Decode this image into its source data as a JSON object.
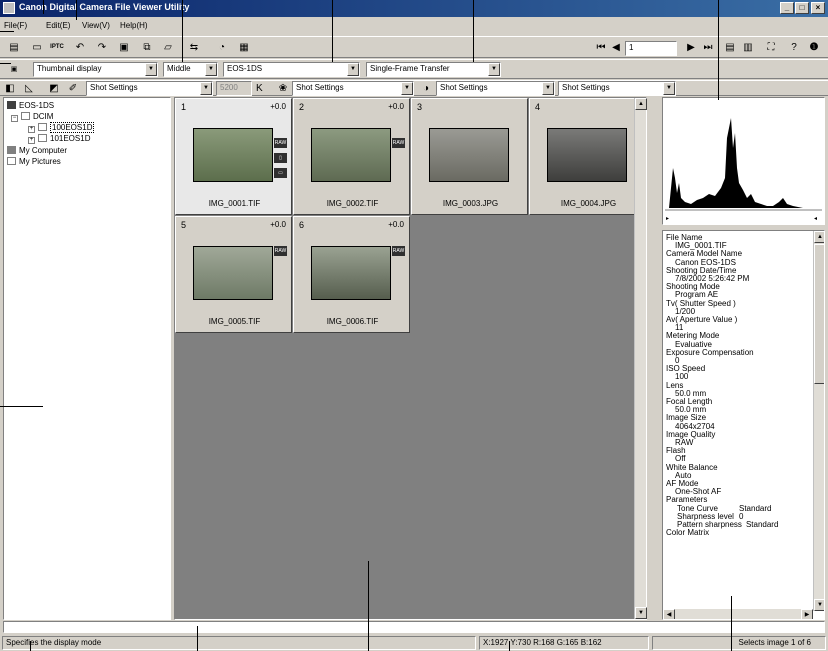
{
  "window": {
    "title": "Canon Digital Camera File Viewer Utility",
    "controls": [
      "_",
      "□",
      "×"
    ]
  },
  "menu": {
    "items": [
      "File(F)",
      "Edit(E)",
      "View(V)",
      "Help(H)"
    ]
  },
  "toolbar1": {
    "iptc": "IPTC",
    "page_value": "1"
  },
  "toolbar2": {
    "display_mode": "Thumbnail display",
    "size": "Middle",
    "camera": "EOS-1DS",
    "transfer": "Single-Frame Transfer"
  },
  "toolbar3": {
    "shot_settings_1": "Shot Settings",
    "kelvin_value": "5200",
    "kelvin_unit": "K",
    "shot_settings_2": "Shot Settings",
    "shot_settings_3": "Shot Settings",
    "shot_settings_4": "Shot Settings"
  },
  "tree": {
    "root": "EOS-1DS",
    "dcim": "DCIM",
    "folder1": "100EOS1D",
    "folder2": "101EOS1D",
    "my_computer": "My Computer",
    "my_pictures": "My Pictures"
  },
  "thumbnails": [
    {
      "num": "1",
      "exp": "+0.0",
      "name": "IMG_0001.TIF"
    },
    {
      "num": "2",
      "exp": "+0.0",
      "name": "IMG_0002.TIF"
    },
    {
      "num": "3",
      "exp": "",
      "name": "IMG_0003.JPG"
    },
    {
      "num": "4",
      "exp": "",
      "name": "IMG_0004.JPG"
    },
    {
      "num": "5",
      "exp": "+0.0",
      "name": "IMG_0005.TIF"
    },
    {
      "num": "6",
      "exp": "+0.0",
      "name": "IMG_0006.TIF"
    }
  ],
  "info": {
    "rows": [
      {
        "label": "File Name",
        "value": "IMG_0001.TIF"
      },
      {
        "label": "Camera Model Name",
        "value": "Canon EOS-1DS"
      },
      {
        "label": "Shooting Date/Time",
        "value": "7/8/2002 5:26:42 PM"
      },
      {
        "label": "Shooting Mode",
        "value": "Program AE"
      },
      {
        "label": "Tv( Shutter Speed )",
        "value": "1/200"
      },
      {
        "label": "Av( Aperture Value )",
        "value": "11"
      },
      {
        "label": "Metering Mode",
        "value": "Evaluative"
      },
      {
        "label": "Exposure Compensation",
        "value": "0"
      },
      {
        "label": "ISO Speed",
        "value": "100"
      },
      {
        "label": "Lens",
        "value": "50.0 mm"
      },
      {
        "label": "Focal Length",
        "value": "50.0 mm"
      },
      {
        "label": "Image Size",
        "value": "4064x2704"
      },
      {
        "label": "Image Quality",
        "value": "RAW"
      },
      {
        "label": "Flash",
        "value": "Off"
      },
      {
        "label": "White Balance",
        "value": "Auto"
      },
      {
        "label": "AF Mode",
        "value": "One-Shot AF"
      }
    ],
    "parameters_label": "Parameters",
    "params": [
      {
        "k": "Tone Curve",
        "v": "Standard"
      },
      {
        "k": "Sharpness level",
        "v": "0"
      },
      {
        "k": "Pattern sharpness",
        "v": "Standard"
      }
    ],
    "color_matrix": "Color Matrix"
  },
  "status": {
    "hint": "Specifies the display mode",
    "coords": "X:1927 Y:730 R:168 G:165 B:162",
    "selection": "Selects image 1 of 6"
  },
  "colors": {
    "title_start": "#0a246a",
    "title_end": "#3a6ea5",
    "face": "#d4d0c8",
    "grid_bg": "#808080"
  }
}
